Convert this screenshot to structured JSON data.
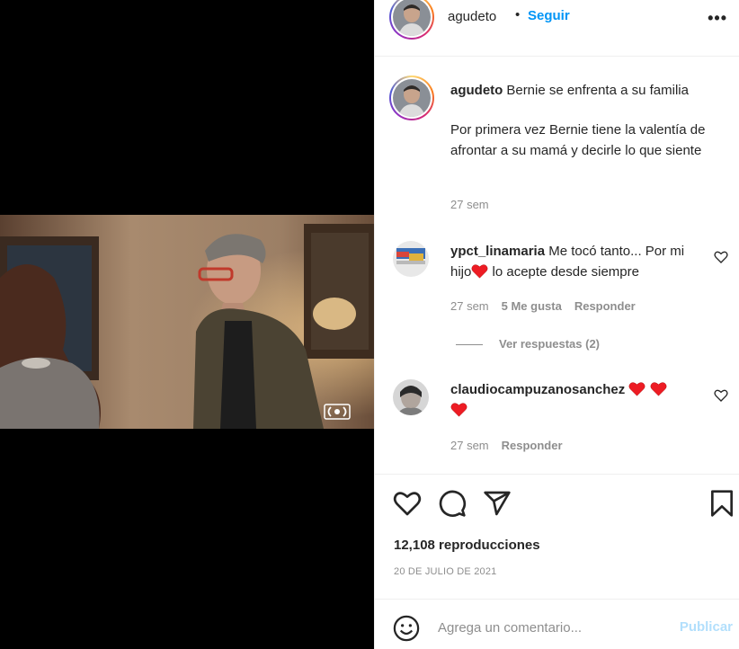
{
  "header": {
    "username": "agudeto",
    "separator": "•",
    "follow_label": "Seguir",
    "more_label": "•••"
  },
  "caption": {
    "username": "agudeto",
    "title": "Bernie se enfrenta a su familia",
    "body": "Por primera vez Bernie tiene la valentía de afrontar a su mamá y decirle lo que siente",
    "time": "27 sem"
  },
  "comments": [
    {
      "username": "ypct_linamaria",
      "text_before": "Me tocó tanto... Por mi hijo",
      "text_after": " lo acepte desde siempre",
      "time": "27 sem",
      "likes": "5 Me gusta",
      "reply_label": "Responder"
    },
    {
      "username": "claudiocampuzanosanchez",
      "time": "27 sem",
      "reply_label": "Responder"
    }
  ],
  "replies_toggle": "Ver respuestas (2)",
  "stats": {
    "views": "12,108 reproducciones",
    "date": "20 DE JULIO DE 2021"
  },
  "comment_box": {
    "placeholder": "Agrega un comentario...",
    "publish_label": "Publicar"
  },
  "colors": {
    "accent": "#0095f6",
    "muted": "#8e8e8e",
    "heart_red": "#ed1c24",
    "publish_disabled": "#b2dffc"
  },
  "icons": [
    "heart-icon",
    "comment-icon",
    "share-icon",
    "bookmark-icon",
    "emoji-icon",
    "more-icon"
  ]
}
